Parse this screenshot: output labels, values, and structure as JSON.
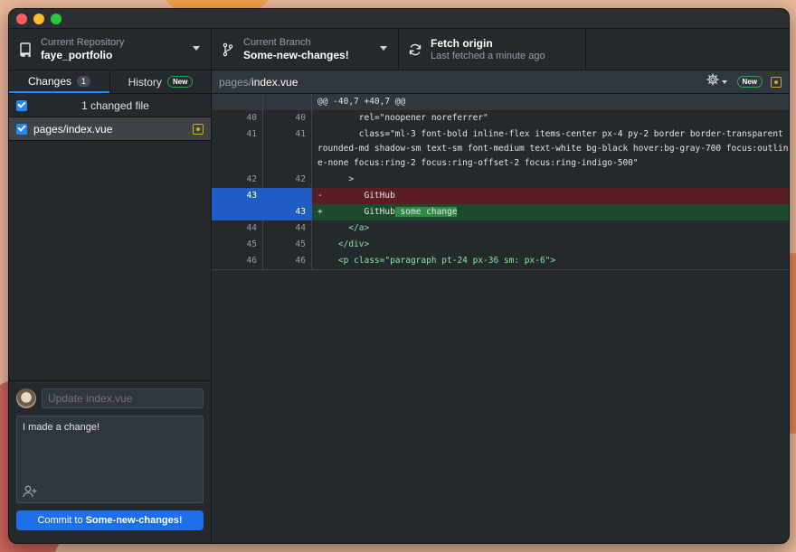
{
  "toolbar": {
    "repo": {
      "label": "Current Repository",
      "value": "faye_portfolio"
    },
    "branch": {
      "label": "Current Branch",
      "value": "Some-new-changes!"
    },
    "fetch": {
      "label": "Fetch origin",
      "value": "Last fetched a minute ago"
    }
  },
  "tabs": {
    "changes": {
      "label": "Changes",
      "count": "1"
    },
    "history": {
      "label": "History",
      "badge": "New"
    }
  },
  "changes": {
    "header": "1 changed file",
    "files": [
      {
        "name": "pages/index.vue"
      }
    ]
  },
  "commit": {
    "summary_placeholder": "Update index.vue",
    "description": "I made a change!",
    "button_prefix": "Commit to",
    "button_branch": "Some-new-changes!"
  },
  "diff": {
    "path_dir": "pages/",
    "path_file": "index.vue",
    "badge": "New",
    "hunk": "@@ -40,7 +40,7 @@",
    "lines": [
      {
        "old": "40",
        "new": "40",
        "code": "        rel=\"noopener noreferrer\""
      },
      {
        "old": "41",
        "new": "41",
        "code": "        class=\"ml-3 font-bold inline-flex items-center px-4 py-2 border border-transparent rounded-md shadow-sm text-sm font-medium text-white bg-black hover:bg-gray-700 focus:outline-none focus:ring-2 focus:ring-offset-2 focus:ring-indigo-500\""
      },
      {
        "old": "42",
        "new": "42",
        "code": "      >"
      },
      {
        "old": "43",
        "new": "",
        "sign": "-",
        "code": "        GitHub"
      },
      {
        "old": "",
        "new": "43",
        "sign": "+",
        "code": "        GitHub",
        "added": " some change"
      },
      {
        "old": "44",
        "new": "44",
        "code": "      </a>"
      },
      {
        "old": "45",
        "new": "45",
        "code": "    </div>"
      },
      {
        "old": "46",
        "new": "46",
        "code": "    <p class=\"paragraph pt-24 px-36 sm: px-6\">"
      }
    ]
  },
  "colors": {
    "accent": "#1f6feb",
    "deleted_bg": "#5a1e22",
    "added_bg": "#1d4a2a",
    "modified": "#d4a72c"
  }
}
